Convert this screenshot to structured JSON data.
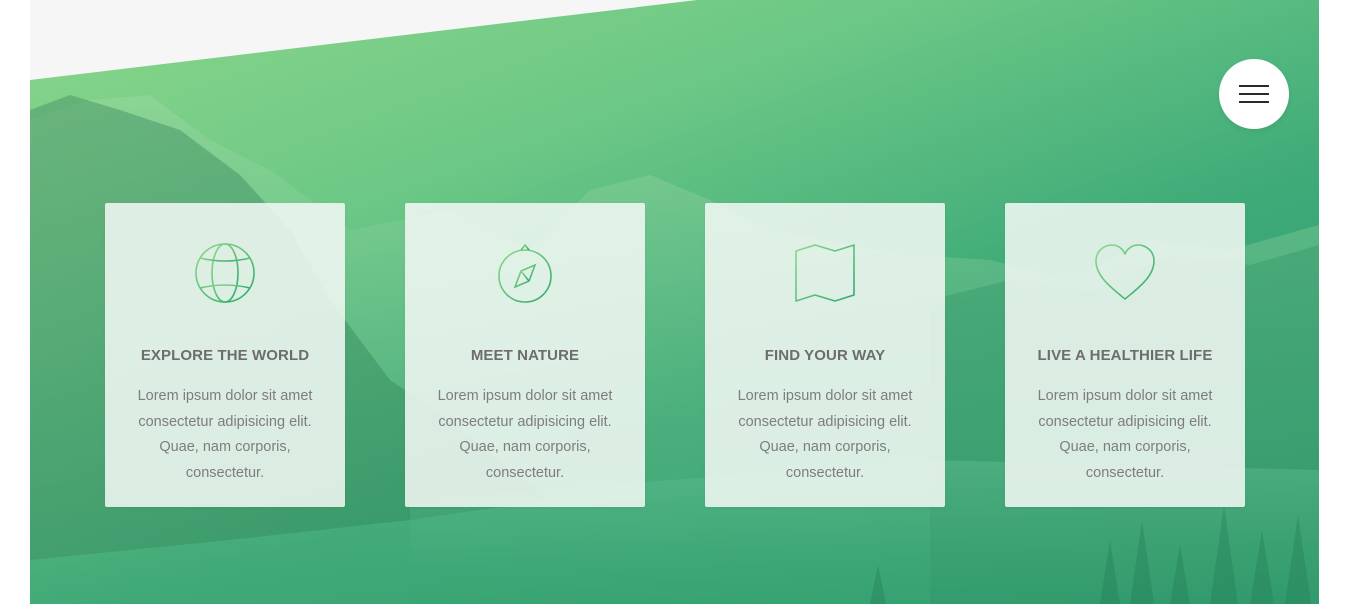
{
  "menu": {
    "icon": "hamburger-menu-icon"
  },
  "colors": {
    "accent_light": "#8bd68a",
    "accent_dark": "#2c9a6c",
    "icon_stroke_start": "#8fd88a",
    "icon_stroke_end": "#2fa96e",
    "card_bg": "#eef6f0",
    "title_text": "#6d6d6d",
    "body_text": "#7d7d7d"
  },
  "features": [
    {
      "icon": "globe-icon",
      "title": "EXPLORE THE WORLD",
      "text": "Lorem ipsum dolor sit amet consectetur adipisicing elit. Quae, nam corporis, consectetur."
    },
    {
      "icon": "compass-icon",
      "title": "MEET NATURE",
      "text": "Lorem ipsum dolor sit amet consectetur adipisicing elit. Quae, nam corporis, consectetur."
    },
    {
      "icon": "map-icon",
      "title": "FIND YOUR WAY",
      "text": "Lorem ipsum dolor sit amet consectetur adipisicing elit. Quae, nam corporis, consectetur."
    },
    {
      "icon": "heart-icon",
      "title": "LIVE A HEALTHIER LIFE",
      "text": "Lorem ipsum dolor sit amet consectetur adipisicing elit. Quae, nam corporis, consectetur."
    }
  ]
}
